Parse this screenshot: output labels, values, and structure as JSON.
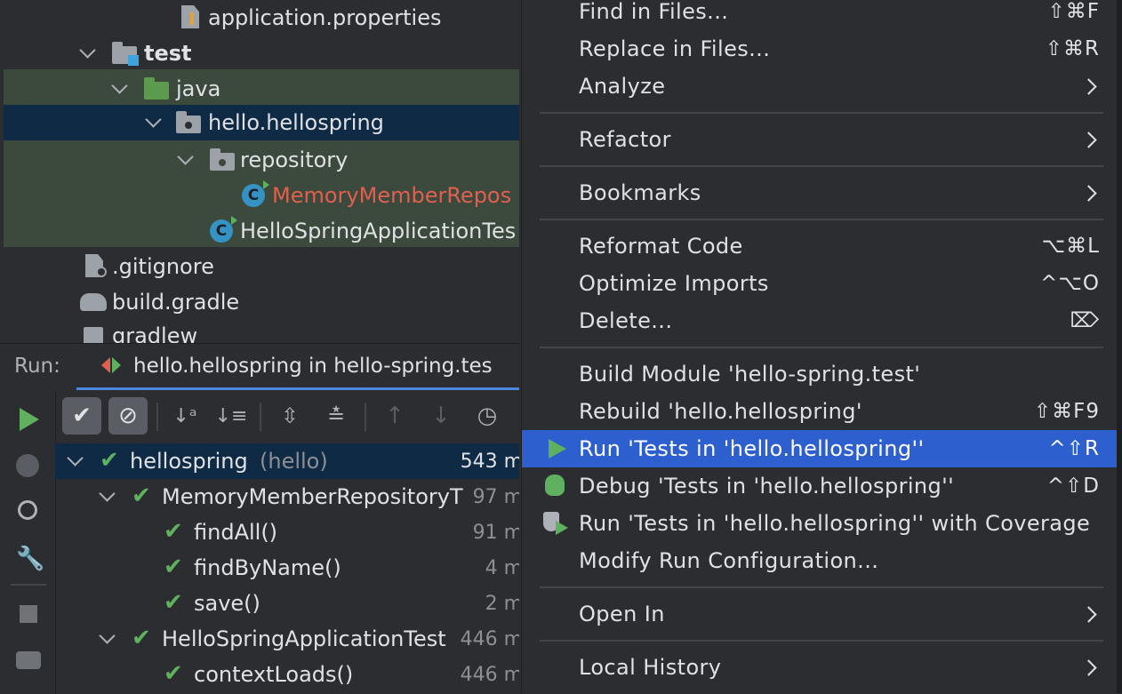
{
  "project_tree": {
    "items": [
      {
        "label": "application.properties"
      },
      {
        "label": "test"
      },
      {
        "label": "java"
      },
      {
        "label": "hello.hellospring"
      },
      {
        "label": "repository"
      },
      {
        "label": "MemoryMemberRepos"
      },
      {
        "label": "HelloSpringApplicationTes"
      },
      {
        "label": ".gitignore"
      },
      {
        "label": "build.gradle"
      },
      {
        "label": "gradlew"
      }
    ]
  },
  "run_panel": {
    "run_label": "Run:",
    "tab_label": "hello.hellospring in hello-spring.tes",
    "tests": [
      {
        "name": "hellospring",
        "suffix": "(hello)",
        "time": "543 m"
      },
      {
        "name": "MemoryMemberRepositoryT",
        "time": "97 m"
      },
      {
        "name": "findAll()",
        "time": "91 m"
      },
      {
        "name": "findByName()",
        "time": "4 m"
      },
      {
        "name": "save()",
        "time": "2 m"
      },
      {
        "name": "HelloSpringApplicationTest",
        "time": "446 m"
      },
      {
        "name": "contextLoads()",
        "time": "446 m"
      }
    ]
  },
  "context_menu": {
    "items": [
      {
        "label": "Find in Files...",
        "shortcut": "⇧⌘F"
      },
      {
        "label": "Replace in Files...",
        "shortcut": "⇧⌘R"
      },
      {
        "label": "Analyze"
      },
      {
        "label": "Refactor"
      },
      {
        "label": "Bookmarks"
      },
      {
        "label": "Reformat Code",
        "shortcut": "⌥⌘L"
      },
      {
        "label": "Optimize Imports",
        "shortcut": "^⌥O"
      },
      {
        "label": "Delete...",
        "shortcut": "⌦"
      },
      {
        "label": "Build Module 'hello-spring.test'"
      },
      {
        "label": "Rebuild 'hello.hellospring'",
        "shortcut": "⇧⌘F9"
      },
      {
        "label": "Run 'Tests in 'hello.hellospring''",
        "shortcut": "^⇧R"
      },
      {
        "label": "Debug 'Tests in 'hello.hellospring''",
        "shortcut": "^⇧D"
      },
      {
        "label": "Run 'Tests in 'hello.hellospring'' with Coverage"
      },
      {
        "label": "Modify Run Configuration..."
      },
      {
        "label": "Open In"
      },
      {
        "label": "Local History"
      }
    ]
  },
  "colors": {
    "selection": "#2e5fcf",
    "tree_selection": "#0e2a44",
    "test_highlight": "#3c4a3d",
    "pass_green": "#5fb05f",
    "error_red": "#e0604f"
  }
}
